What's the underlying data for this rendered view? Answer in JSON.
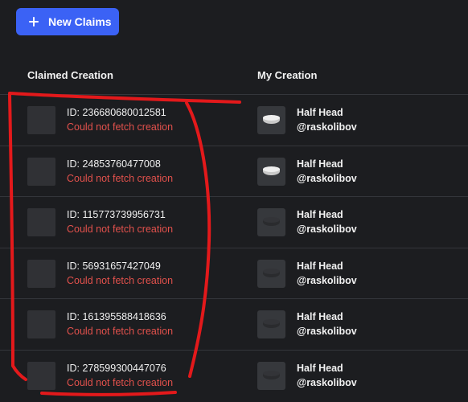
{
  "toolbar": {
    "new_claims_label": "New Claims",
    "new_claims_icon": "plus-icon"
  },
  "table": {
    "headers": {
      "claimed": "Claimed Creation",
      "mine": "My Creation"
    },
    "rows": [
      {
        "id": "ID: 236680680012581",
        "status": "Could not fetch creation",
        "name": "Half Head",
        "user": "@raskolibov",
        "thumb_style": "light"
      },
      {
        "id": "ID: 24853760477008",
        "status": "Could not fetch creation",
        "name": "Half Head",
        "user": "@raskolibov",
        "thumb_style": "light"
      },
      {
        "id": "ID: 115773739956731",
        "status": "Could not fetch creation",
        "name": "Half Head",
        "user": "@raskolibov",
        "thumb_style": "dark"
      },
      {
        "id": "ID: 56931657427049",
        "status": "Could not fetch creation",
        "name": "Half Head",
        "user": "@raskolibov",
        "thumb_style": "dark"
      },
      {
        "id": "ID: 161395588418636",
        "status": "Could not fetch creation",
        "name": "Half Head",
        "user": "@raskolibov",
        "thumb_style": "dark"
      },
      {
        "id": "ID: 278599300447076",
        "status": "Could not fetch creation",
        "name": "Half Head",
        "user": "@raskolibov",
        "thumb_style": "dark"
      }
    ]
  },
  "colors": {
    "background": "#1c1d20",
    "accent": "#3b62f5",
    "error": "#e2514c",
    "annotation": "#e3191b"
  }
}
